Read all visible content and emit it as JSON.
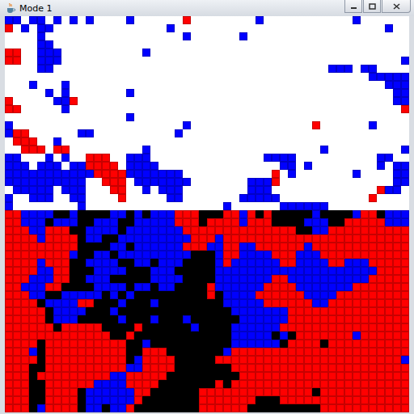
{
  "window": {
    "title": "Mode 1"
  },
  "agents": [
    {
      "symbol": "R",
      "color": "#ff0000"
    },
    {
      "symbol": "B",
      "color": "#0000ff"
    }
  ],
  "zones": [
    {
      "color": "#ffffff",
      "rows": [
        "BB.BB.B.B.B....B......R........B...........B......",
        "R.B.BB..............B..........................B......",
        "....B.................B......B....................",
        "....BB............................................",
        "RR..BBB..........B................................",
        "RR..BBB..........................................B......",
        "....BB..................................BBB.BB",
        ".............................................BBBBBBB",
        "...B...B.......................................BBBBBBB",
        ".....B.B.......B................................BBBBB.",
        "R.....BBR.......................................BBBB.",
        "RR.....B.........................................R",
        "...............B..................................",
        "B.....................B...............R......B......",
        "BRR......BB..........B..................................B.",
        ".RRR..B.................................................BR",
        "..RRR.RR.........B.....................B.........BR",
        "BB...B.B..RRR..BBB..............BBBB..........BB",
        "BBB.BBB.BBRRRR.BBBB...............BB.B........B.BB",
        "BBBBBBBBBBBRRRRBBBBBBB...........R.B.......B....BB",
        "BBBBBBBBBB..RRR.BBBBBBB.......BBBR..............BB",
        ".BBBBB.BBB...RR..B.BBB........BBB.............RBB",
        "B..BBB..BB....R.....BB.......BBBBB...........R..",
        "B........B.................B......BBBBBB.................."
      ]
    },
    {
      "color": "#000000",
      "rows": [
        "RRBBBB..B....BB.B.BBBRRR...RRBR.R.....B....BRR.BBB",
        "RRBBB.BBB..BBB..BBBBBRRR.RRRRBRRR....BBB..RRRRRBBB",
        "RRRBBRRR..BBBB.BBBBBBBRRRRRRRRRRRRRR..BBRRRRRRRRRR",
        "RRRRBRRRR.BB..BBBBBBBBBRRRBRRRRRRRRRRRRRRRRRRRRRRR",
        "RRRRRRRRR....BB.BBBBBBRRRBBRRBBRRRRRRBRRRRRRRRRRRR",
        "RRRRRRRRB..BB.BBBBBBBBB...BRRBBBBRRRBBBRRRRRRRRRRR",
        "RRRRBRRR..BBBB..BB.BBB....BRBBBBBBRRBBBBRRBBBRRRRR",
        "RRRRBBRR...BBBB...BBB.....BBBBBBBBBBBBBBBBBBBBRRRR",
        "RRRBBBRR..BBB.....BBBB....BBBBBBBRRBBBBBBBBBBRRRRR",
        "RRBBBRR....BBBB.BB.BB....RBBBBBBRRRRBBBBBBBRRRRRRR",
        "RRRBB..BBBBB.B.B.........R.BBBBRRRRRRBBBBRRRRRRRRR",
        "RRRR.BBBBRR...B...B........BBBBBRRRRRRBBRRRRRRRRRR",
        "RRRRR.BBBB...B..............BBBBBBBRRRRRRRRRRRRRRR",
        "RRRRR.BBB.....B...B...B......BBBBBBRRRRRRRRRRRRRRR",
        "RRRRRR.RRRRR....R......B....BBBBBBRRRRRRRRRRRRRRRR",
        "RRRRRRRRRRRRR..R............BBBBB.B.RRRRRRRBRRRRRR",
        "RRRR.RRRRRRRRRR..B..........BBBBBB.RRRR.RRRRRRRRRR",
        "RRRB.RRRRRRRRRR..RRR.......BRRRRRRRRRRRRRRRRRRRRRR",
        "RRRR.RRRRRRRRRR.BRRRR.....RRRRRRRRRRRRRRRRRRRRRRRB",
        "RRR..RRRRRRRRRRBBRRRR.......RRRRRRRRRRRRRRRRRRRRRR",
        "RRR.RRRRRRRRRBBRRRRR.........RRRRRRRRRRRRRRRRRRRRR",
        "RRR..RRRRRRBBBBRRRR.......R.RRRRRRRRRRRRRRRRRRRRRR",
        "RRR..RRRR.BBBBBBRR......RRRRRRRRRRRRRR.RRRRRRRRRRR",
        "RRR..RRRR.BBBBBBR.......RRRRRRR...RRRRRRRRRRRRRRRR",
        "RRR.BRRRR.BB.BBR........RRRRRR.........RRRRRRRRRRRRRRR"
      ]
    }
  ]
}
